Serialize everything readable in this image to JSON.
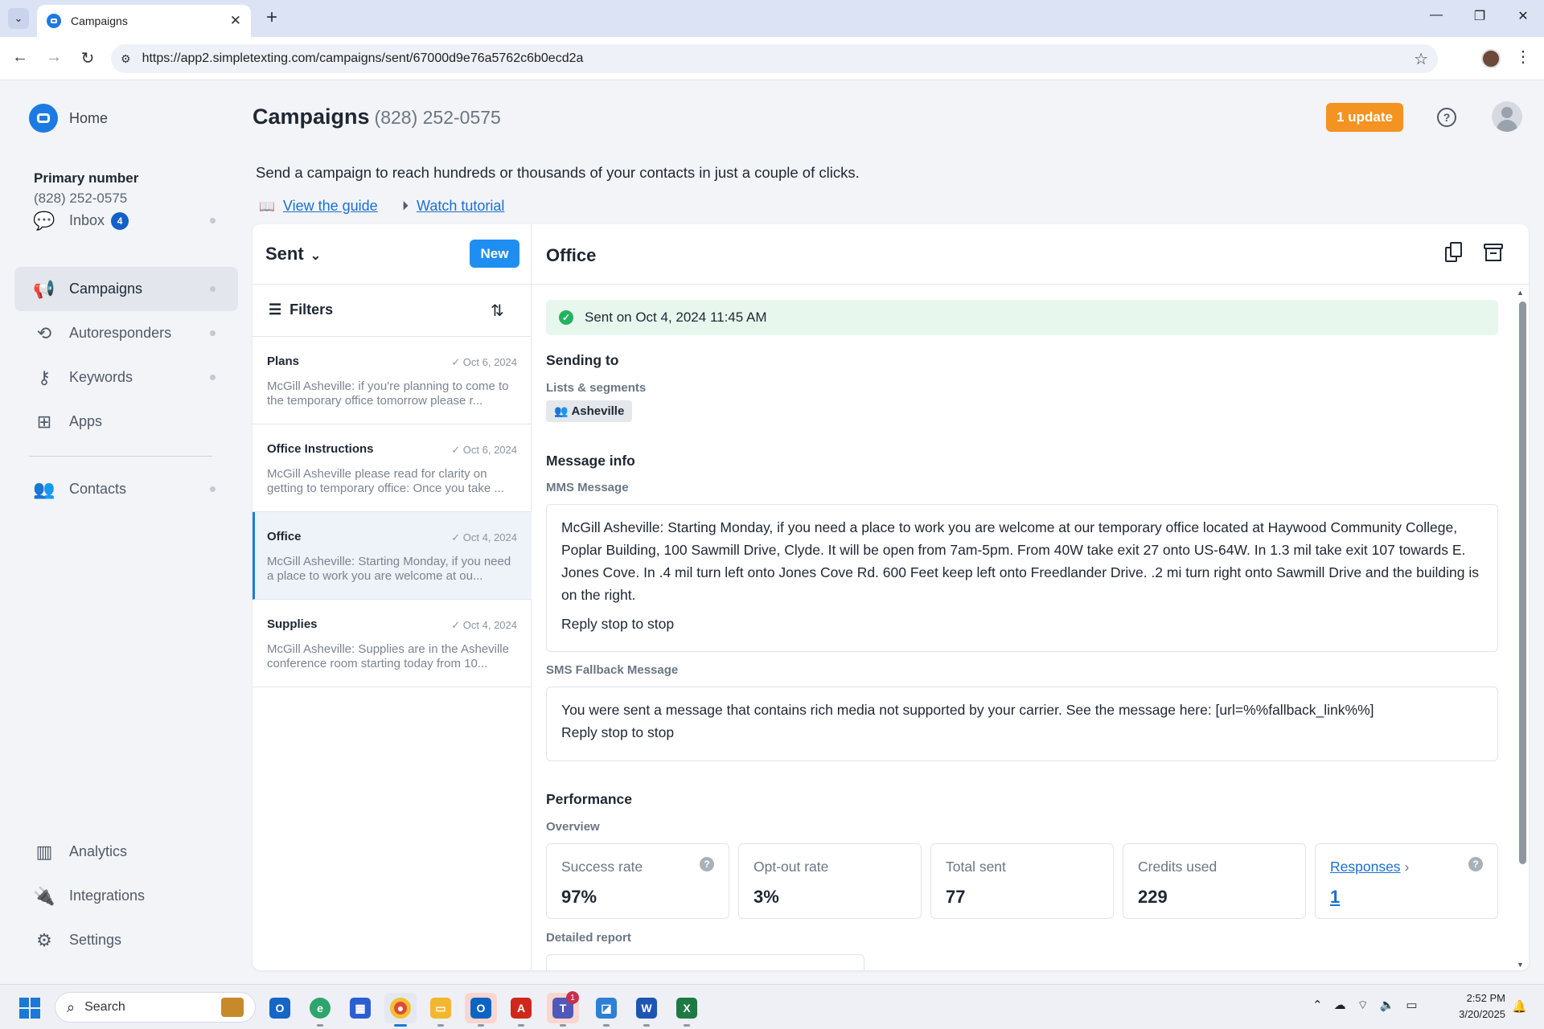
{
  "browser": {
    "tab_title": "Campaigns",
    "url": "https://app2.simpletexting.com/campaigns/sent/67000d9e76a5762c6b0ecd2a",
    "icons": [
      "tab-list-icon",
      "close-icon",
      "plus-icon",
      "minimize-icon",
      "restore-icon",
      "window-close-icon",
      "back-icon",
      "forward-icon",
      "reload-icon",
      "site-settings-icon",
      "star-icon",
      "menu-dots-icon"
    ]
  },
  "sidebar": {
    "home_label": "Home",
    "primary_number_label": "Primary number",
    "primary_number": "(828) 252-0575",
    "items": [
      {
        "label": "Inbox",
        "badge": "4",
        "icon": "chat-icon"
      },
      {
        "label": "Campaigns",
        "icon": "megaphone-icon",
        "active": true
      },
      {
        "label": "Autoresponders",
        "icon": "autoresponder-icon"
      },
      {
        "label": "Keywords",
        "icon": "key-icon"
      },
      {
        "label": "Apps",
        "icon": "apps-grid-icon"
      },
      {
        "label": "Contacts",
        "icon": "contacts-icon"
      },
      {
        "label": "Analytics",
        "icon": "bar-chart-icon"
      },
      {
        "label": "Integrations",
        "icon": "plug-icon"
      },
      {
        "label": "Settings",
        "icon": "gear-icon"
      }
    ]
  },
  "header": {
    "title": "Campaigns",
    "phone": "(828) 252-0575",
    "update_label": "1 update",
    "description": "Send a campaign to reach hundreds or thousands of your contacts in just a couple of clicks.",
    "guide_link": "View the guide",
    "tutorial_link": "Watch tutorial",
    "accent_color": "#f39322"
  },
  "list": {
    "folder": "Sent",
    "new_label": "New",
    "filters_label": "Filters",
    "items": [
      {
        "name": "Plans",
        "date": "Oct 6, 2024",
        "preview": "McGill Asheville: if you're planning to come to the temporary office tomorrow please r..."
      },
      {
        "name": "Office Instructions",
        "date": "Oct 6, 2024",
        "preview": "McGill Asheville please read for clarity on getting to temporary office: Once you take ..."
      },
      {
        "name": "Office",
        "date": "Oct 4, 2024",
        "preview": "McGill Asheville: Starting Monday, if you need a place to work you are welcome at ou...",
        "selected": true
      },
      {
        "name": "Supplies",
        "date": "Oct 4, 2024",
        "preview": "McGill Asheville: Supplies are in the Asheville conference room starting today from 10..."
      }
    ]
  },
  "detail": {
    "title": "Office",
    "sent_status": "Sent on Oct 4, 2024 11:45 AM",
    "sending_to_title": "Sending to",
    "lists_label": "Lists & segments",
    "segment": "Asheville",
    "message_info_title": "Message info",
    "mms_label": "MMS Message",
    "mms_body": "McGill Asheville: Starting Monday, if you need a place to work you are welcome at our temporary office located at Haywood Community College, Poplar Building, 100 Sawmill Drive, Clyde.  It will be open from 7am-5pm. From 40W take exit 27 onto US-64W. In 1.3 mil take exit 107 towards E. Jones Cove. In .4 mil turn left onto Jones Cove Rd. 600 Feet keep left onto Freedlander Drive. .2 mi turn right onto Sawmill Drive and the building is on the right.",
    "mms_stop": "Reply stop to stop",
    "sms_label": "SMS Fallback Message",
    "sms_body": "You were sent a message that contains rich media not supported by your carrier. See the message here: [url=%%fallback_link%%]",
    "sms_stop": "Reply stop to stop",
    "performance_title": "Performance",
    "overview_label": "Overview",
    "stats": [
      {
        "label": "Success rate",
        "value": "97%"
      },
      {
        "label": "Opt-out rate",
        "value": "3%"
      },
      {
        "label": "Total sent",
        "value": "77"
      },
      {
        "label": "Credits used",
        "value": "229"
      },
      {
        "label": "Responses",
        "value": "1"
      }
    ],
    "detailed_report_label": "Detailed report",
    "success_color": "#22b35e"
  },
  "taskbar": {
    "search_placeholder": "Search",
    "time": "2:52 PM",
    "date": "3/20/2025",
    "teams_badge": "1"
  }
}
